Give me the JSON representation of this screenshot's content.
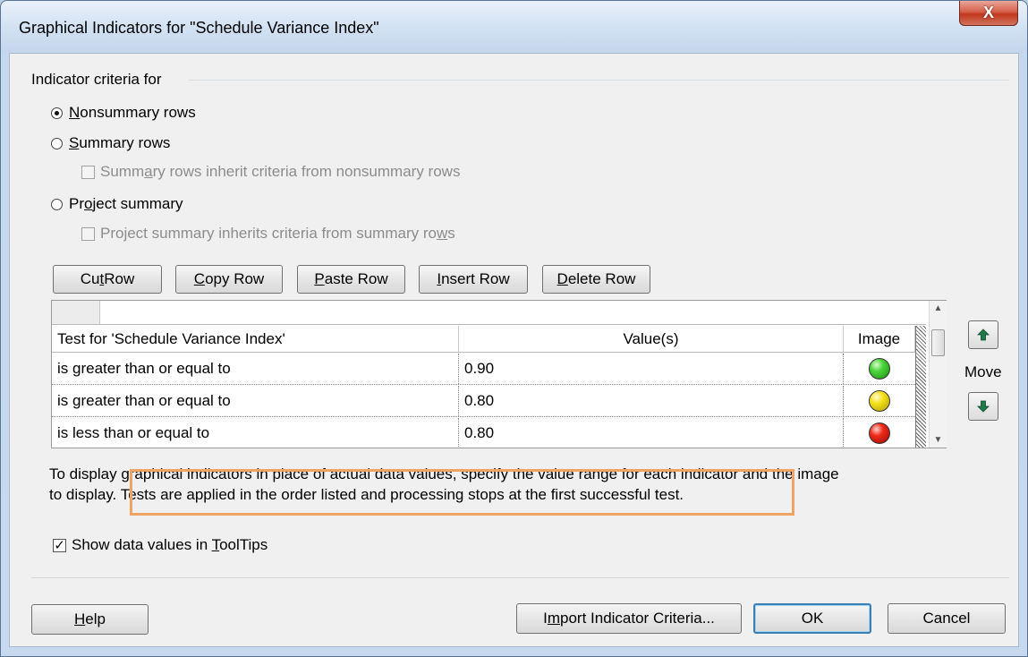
{
  "window": {
    "title": "Graphical Indicators for \"Schedule Variance Index\"",
    "close_label": "X"
  },
  "criteria": {
    "group_label": "Indicator criteria for",
    "nonsummary": {
      "pre": "",
      "key": "N",
      "post": "onsummary rows",
      "selected": true
    },
    "summary": {
      "pre": "",
      "key": "S",
      "post": "ummary rows",
      "selected": false
    },
    "summary_inherit": {
      "pre": "Summ",
      "key": "a",
      "post": "ry rows inherit criteria from nonsummary rows",
      "checked": false
    },
    "project_summary": {
      "pre": "Pr",
      "key": "o",
      "post": "ject summary",
      "selected": false
    },
    "project_inherit": {
      "pre": "Project summary inherits criteria from summary ro",
      "key": "w",
      "post": "s",
      "checked": false
    }
  },
  "toolbar": {
    "cut": {
      "pre": "Cu",
      "key": "t",
      "post": " Row"
    },
    "copy": {
      "pre": "",
      "key": "C",
      "post": "opy Row"
    },
    "paste": {
      "pre": "",
      "key": "P",
      "post": "aste Row"
    },
    "insert": {
      "pre": "",
      "key": "I",
      "post": "nsert Row"
    },
    "delete": {
      "pre": "",
      "key": "D",
      "post": "elete Row"
    }
  },
  "grid": {
    "headers": [
      "Test for 'Schedule Variance Index'",
      "Value(s)",
      "Image"
    ],
    "rows": [
      {
        "test": "is greater than or equal to",
        "value": "0.90",
        "image": "green-light-icon"
      },
      {
        "test": "is greater than or equal to",
        "value": "0.80",
        "image": "yellow-light-icon"
      },
      {
        "test": "is less than or equal to",
        "value": "0.80",
        "image": "red-light-icon"
      }
    ]
  },
  "move": {
    "label": "Move",
    "up_icon": "arrow-up-icon",
    "down_icon": "arrow-down-icon"
  },
  "info": {
    "line1": "To display graphical indicators in place of actual data values, specify the value range for each indicator and the image",
    "line2a": "to display.  ",
    "line2b": "Tests are applied in the order listed and processing stops at the first successful test."
  },
  "tooltips": {
    "pre": "Show data values in ",
    "key": "T",
    "post": "oolTips",
    "checked": true
  },
  "footer": {
    "help": {
      "pre": "",
      "key": "H",
      "post": "elp"
    },
    "import": {
      "pre": "I",
      "key": "m",
      "post": "port Indicator Criteria..."
    },
    "ok": "OK",
    "cancel": "Cancel"
  },
  "colors": {
    "highlight_box": "#f0a464",
    "default_button_border": "#3c7fb1"
  }
}
